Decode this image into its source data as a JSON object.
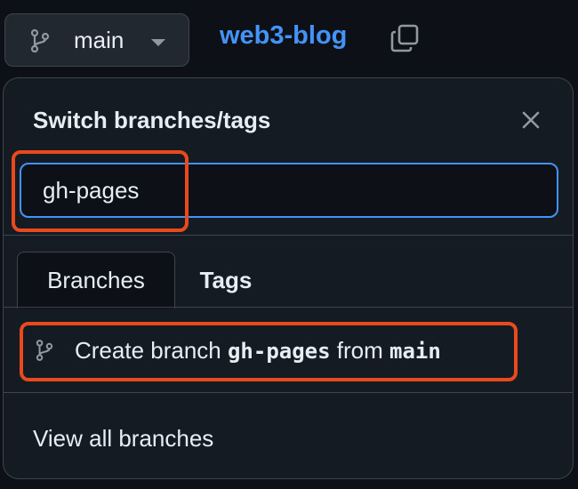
{
  "header": {
    "branch_label": "main",
    "repo_name": "web3-blog"
  },
  "menu": {
    "title": "Switch branches/tags",
    "filter_value": "gh-pages",
    "tabs": [
      {
        "label": "Branches",
        "active": true
      },
      {
        "label": "Tags",
        "active": false
      }
    ],
    "create": {
      "prefix": "Create branch ",
      "new_branch": "gh-pages",
      "middle": " from ",
      "source_branch": "main"
    },
    "view_all_label": "View all branches"
  },
  "icons": {
    "branch": "git-branch-icon",
    "dropdown": "caret-down-icon",
    "copy": "copy-icon",
    "close": "close-icon"
  },
  "colors": {
    "background": "#0d1117",
    "menu_background": "#151b23",
    "border": "#3d444d",
    "accent": "#4493f8",
    "highlight": "#e8491d",
    "text": "#e6edf3",
    "muted": "#9198a1"
  }
}
